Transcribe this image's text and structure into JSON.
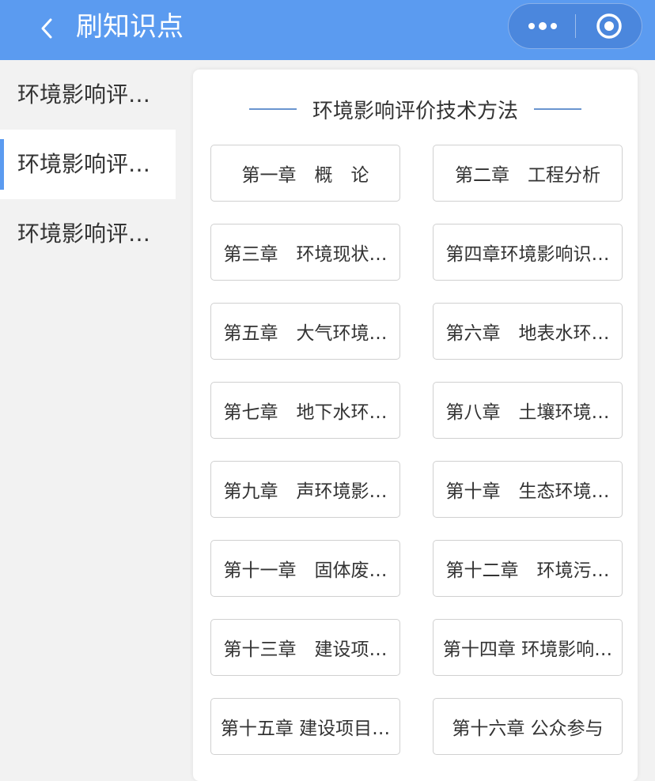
{
  "header": {
    "title": "刷知识点",
    "back_icon": "chevron-left-icon",
    "more_icon": "more-dots-icon",
    "close_icon": "target-circle-icon"
  },
  "sidebar": {
    "items": [
      {
        "label": "环境影响评…"
      },
      {
        "label": "环境影响评…"
      },
      {
        "label": "环境影响评…"
      }
    ]
  },
  "main": {
    "section_title": "环境影响评价技术方法",
    "chapters": [
      "第一章　概　论",
      "第二章　工程分析",
      "第三章　环境现状…",
      "第四章环境影响识…",
      "第五章　大气环境…",
      "第六章　地表水环…",
      "第七章　地下水环…",
      "第八章　土壤环境…",
      "第九章　声环境影…",
      "第十章　生态环境…",
      "第十一章　固体废…",
      "第十二章　环境污…",
      "第十三章　建设项…",
      "第十四章 环境影响…",
      "第十五章 建设项目…",
      "第十六章 公众参与"
    ]
  },
  "colors": {
    "accent": "#5b9bf0",
    "divider_line": "#6a95cf"
  }
}
